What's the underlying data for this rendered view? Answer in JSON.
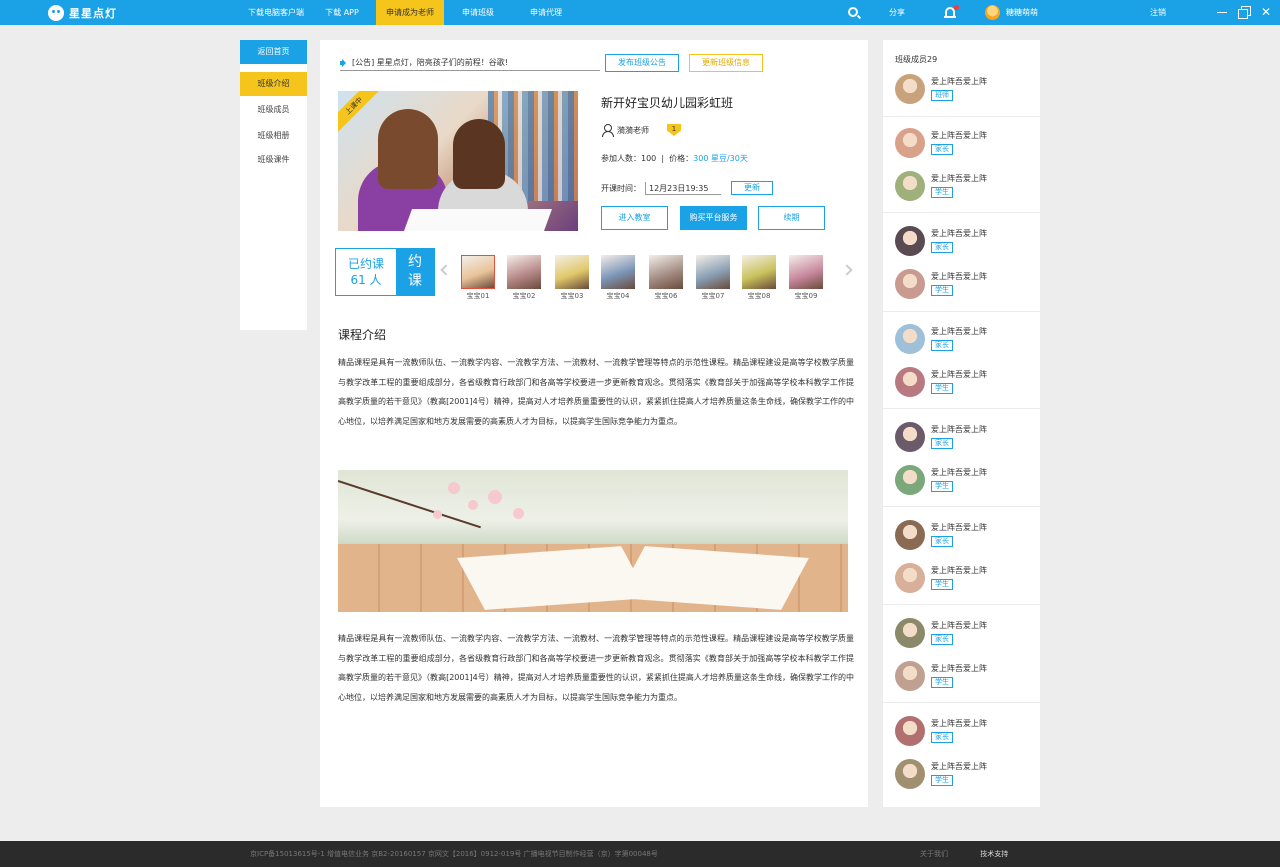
{
  "app": {
    "name": "星星点灯"
  },
  "nav": {
    "items": [
      {
        "label": "下载电脑客户端",
        "active": false
      },
      {
        "label": "下载 APP",
        "active": false
      },
      {
        "label": "申请成为老师",
        "active": true
      },
      {
        "label": "申请班级",
        "active": false
      },
      {
        "label": "申请代理",
        "active": false
      }
    ],
    "share": "分享",
    "username": "糖糖萌萌",
    "logout": "注销"
  },
  "sidebar": {
    "back": "返回首页",
    "items": [
      {
        "label": "班级介绍",
        "active": true
      },
      {
        "label": "班级成员",
        "active": false
      },
      {
        "label": "班级相册",
        "active": false
      },
      {
        "label": "班级课件",
        "active": false
      }
    ]
  },
  "notice": {
    "text": "[公告] 星星点灯，陪亮孩子们的前程！谷歌!",
    "publish_btn": "发布班级公告",
    "update_btn": "更新班级信息"
  },
  "course": {
    "ribbon": "上课中",
    "title": "新开好宝贝幼儿园彩虹班",
    "teacher": "漪漪老师",
    "level": "1",
    "participants_label": "参加人数：",
    "participants": "100",
    "price_label": "价格：",
    "price_amount": "300",
    "price_unit": "星豆/30天",
    "time_label": "开课时间：",
    "time_value": "12月23日19:35",
    "change_btn": "更新",
    "enter_btn": "进入教室",
    "buy_btn": "购买平台服务",
    "renew_btn": "续期"
  },
  "booked": {
    "line1": "已约课",
    "line2": "61 人",
    "btn_line1": "约",
    "btn_line2": "课",
    "students": [
      {
        "name": "宝宝01",
        "color": "#e8c39a"
      },
      {
        "name": "宝宝02",
        "color": "#b98a8a"
      },
      {
        "name": "宝宝03",
        "color": "#e0c86a"
      },
      {
        "name": "宝宝04",
        "color": "#7b95b8"
      },
      {
        "name": "宝宝06",
        "color": "#a58f86"
      },
      {
        "name": "宝宝07",
        "color": "#8aa0b5"
      },
      {
        "name": "宝宝08",
        "color": "#c9c25c"
      },
      {
        "name": "宝宝09",
        "color": "#c98aa0"
      }
    ]
  },
  "intro": {
    "title": "课程介绍",
    "paragraph": "精品课程是具有一流教师队伍、一流教学内容、一流教学方法、一流教材、一流教学管理等特点的示范性课程。精品课程建设是高等学校教学质量与教学改革工程的重要组成部分，各省级教育行政部门和各高等学校要进一步更新教育观念。贯彻落实《教育部关于加强高等学校本科教学工作提高教学质量的若干意见》（教高[2001]4号）精神，提高对人才培养质量重要性的认识，紧紧抓住提高人才培养质量这条生命线，确保教学工作的中心地位，以培养满足国家和地方发展需要的高素质人才为目标，以提高学生国际竞争能力为重点。"
  },
  "members": {
    "title": "班级成员29",
    "list": [
      {
        "name": "爱上阵吾爱上阵",
        "role": "班师",
        "color": "#c7a27a"
      },
      {
        "name": "爱上阵吾爱上阵",
        "role": "家长",
        "color": "#d9a08a"
      },
      {
        "name": "爱上阵吾爱上阵",
        "role": "学生",
        "color": "#9fb07a"
      },
      {
        "name": "爱上阵吾爱上阵",
        "role": "家长",
        "color": "#5a4a52"
      },
      {
        "name": "爱上阵吾爱上阵",
        "role": "学生",
        "color": "#c99a90"
      },
      {
        "name": "爱上阵吾爱上阵",
        "role": "家长",
        "color": "#9ec0d8"
      },
      {
        "name": "爱上阵吾爱上阵",
        "role": "学生",
        "color": "#b87a80"
      },
      {
        "name": "爱上阵吾爱上阵",
        "role": "家长",
        "color": "#6a5a6a"
      },
      {
        "name": "爱上阵吾爱上阵",
        "role": "学生",
        "color": "#7aa87a"
      },
      {
        "name": "爱上阵吾爱上阵",
        "role": "家长",
        "color": "#8a6a52"
      },
      {
        "name": "爱上阵吾爱上阵",
        "role": "学生",
        "color": "#d8b09a"
      },
      {
        "name": "爱上阵吾爱上阵",
        "role": "家长",
        "color": "#8a8a6a"
      },
      {
        "name": "爱上阵吾爱上阵",
        "role": "学生",
        "color": "#c0a090"
      },
      {
        "name": "爱上阵吾爱上阵",
        "role": "家长",
        "color": "#b07070"
      },
      {
        "name": "爱上阵吾爱上阵",
        "role": "学生",
        "color": "#a09070"
      }
    ]
  },
  "footer": {
    "left": "京ICP备15013615号-1    增值电信业务 京B2-20160157    京网文【2016】0912-019号    广播电视节目制作经营（京）字第00048号",
    "about": "关于我们",
    "support": "技术支持"
  },
  "colors": {
    "primary": "#1aa1e6",
    "accent": "#f5c51c",
    "footer": "#2b2b2b"
  }
}
